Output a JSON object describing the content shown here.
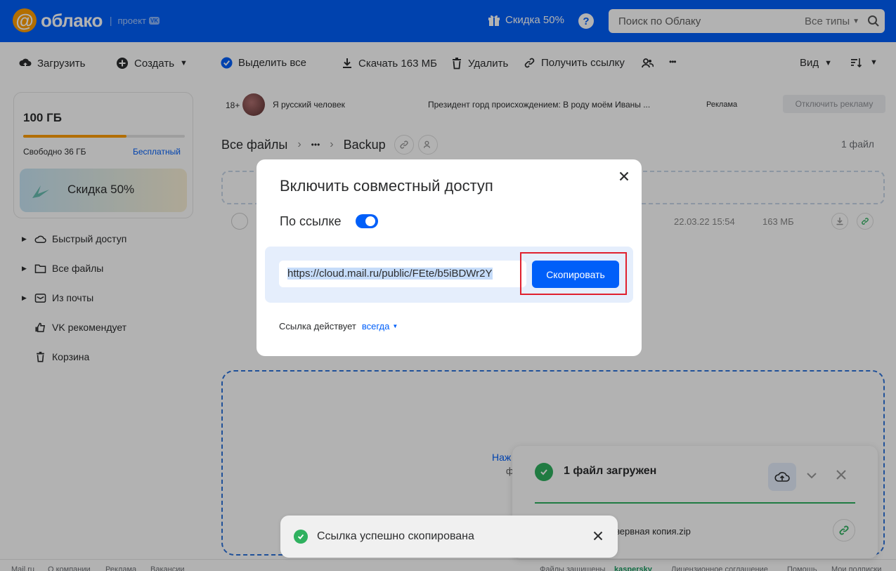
{
  "header": {
    "logo_text": "облако",
    "logo_project": "проект",
    "logo_badge": "VK",
    "promo_label": "Скидка 50%",
    "help_label": "?",
    "search_placeholder": "Поиск по Облаку",
    "search_type": "Все типы"
  },
  "toolbar": {
    "upload": "Загрузить",
    "create": "Создать",
    "select_all": "Выделить все",
    "download": "Скачать 163 МБ",
    "delete": "Удалить",
    "get_link": "Получить ссылку",
    "more": "•••",
    "view": "Вид"
  },
  "sidebar": {
    "storage_total": "100 ГБ",
    "storage_used_fraction": 0.64,
    "storage_free": "Свободно 36 ГБ",
    "plan": "Бесплатный",
    "promo_card": "Скидка 50%",
    "items": [
      {
        "label": "Быстрый доступ"
      },
      {
        "label": "Все файлы"
      },
      {
        "label": "Из почты"
      },
      {
        "label": "VK рекомендует"
      },
      {
        "label": "Корзина"
      }
    ]
  },
  "ad": {
    "age": "18+",
    "title": "Я русский человек",
    "text": "Президент горд происхождением: В роду моём Иваны ...",
    "label": "Реклама",
    "disable": "Отключить рекламу"
  },
  "breadcrumb": {
    "root": "Все файлы",
    "ellipsis": "•••",
    "current": "Backup",
    "file_count": "1 файл"
  },
  "file_row": {
    "date": "22.03.22 15:54",
    "size": "163 МБ"
  },
  "dropzone": {
    "text1": "Наж",
    "text2": "ф"
  },
  "dialog": {
    "title": "Включить совместный доступ",
    "switch_label": "По ссылке",
    "link": "https://cloud.mail.ru/public/FEte/b5iBDWr2Y",
    "copy_button": "Скопировать",
    "expire_label": "Ссылка действует",
    "expire_value": "всегда"
  },
  "upload_panel": {
    "title": "1 файл загружен",
    "file": "езервная копия.zip"
  },
  "toast": {
    "text": "Ссылка успешно скопирована"
  },
  "footer": {
    "links": [
      "Mail.ru",
      "О компании",
      "Реклама",
      "Вакансии"
    ],
    "right_prefix": "Файлы защищены",
    "right_brand": "kaspersky",
    "right_links": [
      "Лицензионное соглашение",
      "Помощь",
      "Мои подписки"
    ]
  },
  "colors": {
    "brand_blue": "#005ff9",
    "accent_orange": "#ff9e00",
    "success_green": "#2fb15f",
    "highlight_red": "#e0202e"
  }
}
